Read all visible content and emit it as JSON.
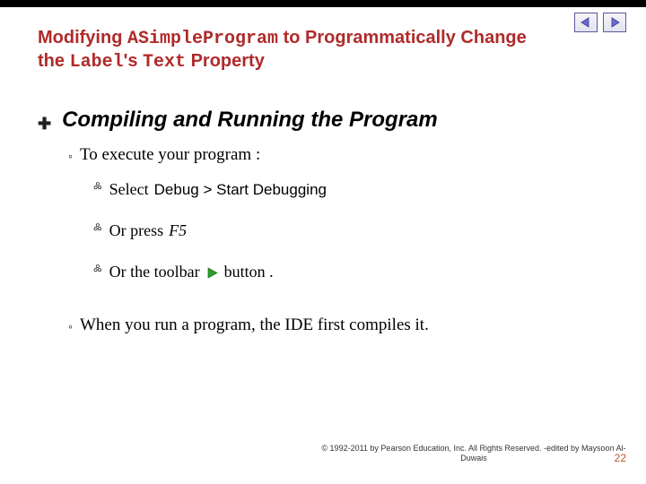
{
  "title": {
    "pre1": "Modifying ",
    "code1": "ASimpleProgram",
    "mid1": " to Programmatically Change the ",
    "code2": "Label",
    "mid2": "'s ",
    "code3": "Text",
    "post": " Property"
  },
  "section": {
    "heading": "Compiling and Running the Program"
  },
  "items": {
    "exec_intro": "To execute your program  :",
    "select_prefix": "Select ",
    "select_path": "Debug > Start Debugging",
    "press_prefix": "Or press ",
    "press_key": "F5",
    "toolbar_prefix": "Or the toolbar",
    "toolbar_suffix": "  button .",
    "compile_note": "When you run a program, the IDE first compiles it."
  },
  "footer": {
    "copyright": "© 1992-2011 by Pearson Education, Inc. All Rights Reserved. -edited by Maysoon Al-Duwais",
    "page": "22"
  },
  "nav": {
    "prev": "prev",
    "next": "next"
  }
}
